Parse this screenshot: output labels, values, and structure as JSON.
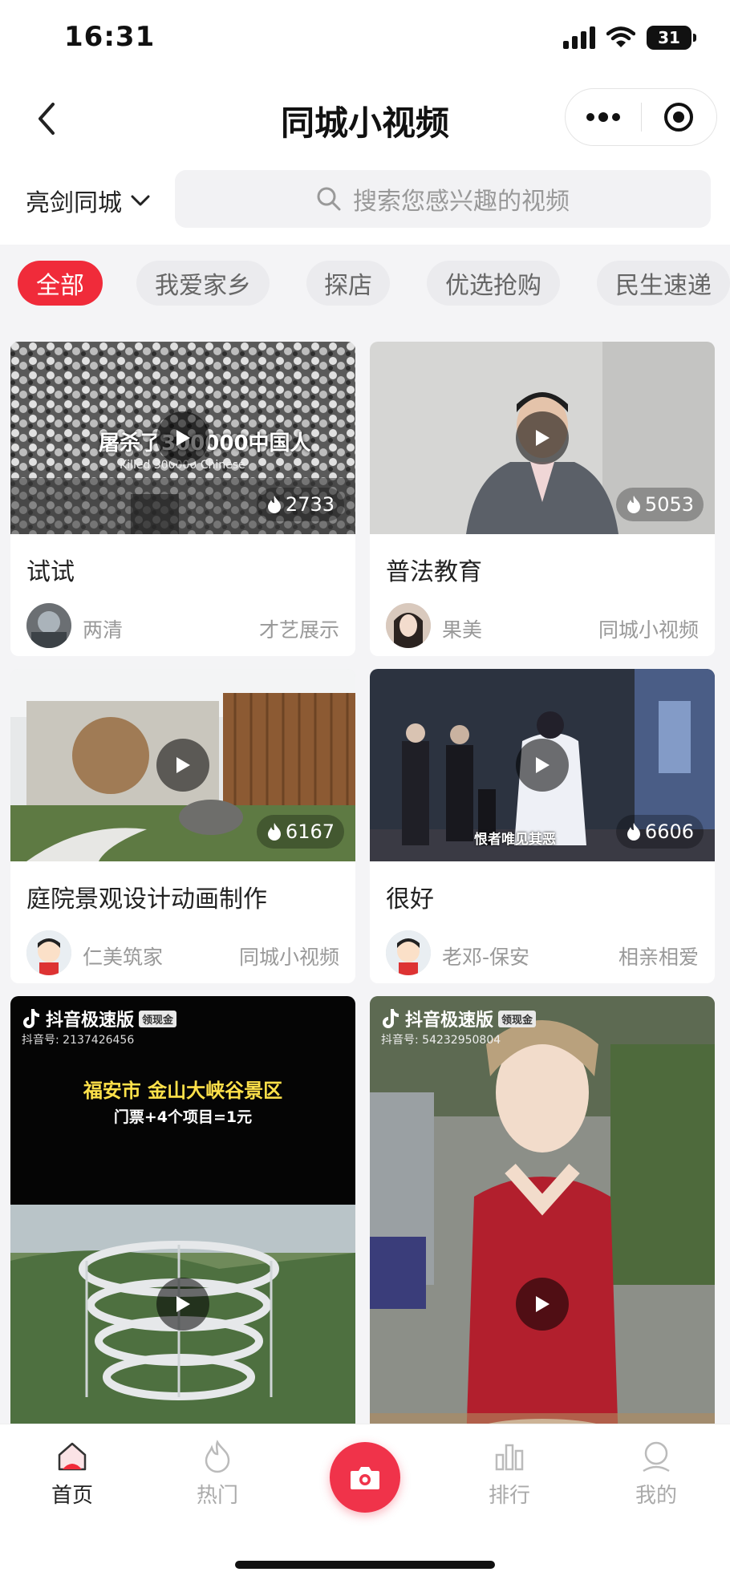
{
  "status_bar": {
    "time": "16:31",
    "battery": "31"
  },
  "nav": {
    "title": "同城小视频"
  },
  "location": {
    "city": "亮剑同城"
  },
  "search": {
    "placeholder": "搜索您感兴趣的视频"
  },
  "tabs": [
    "全部",
    "我爱家乡",
    "探店",
    "优选抢购",
    "民生速递"
  ],
  "active_tab": "全部",
  "videos": [
    {
      "title": "试试",
      "author": "两清",
      "category": "才艺展示",
      "heat": "2733",
      "caption_cn": "屠杀了300000中国人",
      "caption_en": "Killed 300000 Chinese"
    },
    {
      "title": "普法教育",
      "author": "果美",
      "category": "同城小视频",
      "heat": "5053"
    },
    {
      "title": "庭院景观设计动画制作",
      "author": "仁美筑家",
      "category": "同城小视频",
      "heat": "6167"
    },
    {
      "title": "很好",
      "author": "老邓-保安",
      "category": "相亲相爱",
      "heat": "6606",
      "caption": "恨者唯见其恶"
    },
    {
      "app_badge": "抖音极速版",
      "badge_tag": "领现金",
      "douyin_id": "抖音号: 2137426456",
      "headline": "福安市 金山大峡谷景区",
      "subline": "门票+4个项目=1元"
    },
    {
      "app_badge": "抖音极速版",
      "badge_tag": "领现金",
      "douyin_id": "抖音号: 54232950804"
    }
  ],
  "tab_bar": [
    {
      "label": "首页",
      "icon": "home-icon",
      "active": true
    },
    {
      "label": "热门",
      "icon": "flame-icon",
      "active": false
    },
    {
      "label": "",
      "icon": "camera-icon",
      "active": false
    },
    {
      "label": "排行",
      "icon": "bar-chart-icon",
      "active": false
    },
    {
      "label": "我的",
      "icon": "user-icon",
      "active": false
    }
  ],
  "colors": {
    "accent": "#f02b3a",
    "camera": "#f0334a"
  }
}
